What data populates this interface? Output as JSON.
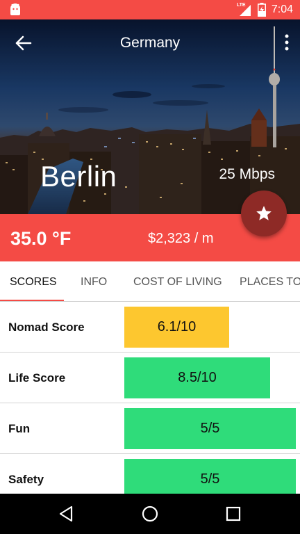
{
  "status_bar": {
    "time": "7:04",
    "network": "LTE",
    "icons": [
      "android-icon",
      "signal-icon",
      "battery-icon"
    ]
  },
  "header": {
    "title": "Germany",
    "back_icon": "arrow-left-icon",
    "menu_icon": "more-vertical-icon"
  },
  "hero": {
    "city": "Berlin",
    "internet_speed": "25 Mbps"
  },
  "info_bar": {
    "temperature": "35.0 °F",
    "cost": "$2,323 / m"
  },
  "fab": {
    "icon": "star-icon"
  },
  "tabs": [
    {
      "label": "SCORES",
      "active": true
    },
    {
      "label": "INFO",
      "active": false
    },
    {
      "label": "COST OF LIVING",
      "active": false
    },
    {
      "label": "PLACES TO",
      "active": false
    }
  ],
  "scores": [
    {
      "label": "Nomad Score",
      "value": "6.1/10",
      "fraction": 0.61,
      "color": "#fdc72f"
    },
    {
      "label": "Life Score",
      "value": "8.5/10",
      "fraction": 0.85,
      "color": "#2fdc7a"
    },
    {
      "label": "Fun",
      "value": "5/5",
      "fraction": 1.0,
      "color": "#2fdc7a"
    },
    {
      "label": "Safety",
      "value": "5/5",
      "fraction": 1.0,
      "color": "#2fdc7a"
    }
  ],
  "colors": {
    "accent": "#f44b45",
    "fab": "#8e2a26",
    "score_yellow": "#fdc72f",
    "score_green": "#2fdc7a"
  },
  "nav_bar": {
    "icons": [
      "back-triangle-icon",
      "home-circle-icon",
      "recents-square-icon"
    ]
  }
}
